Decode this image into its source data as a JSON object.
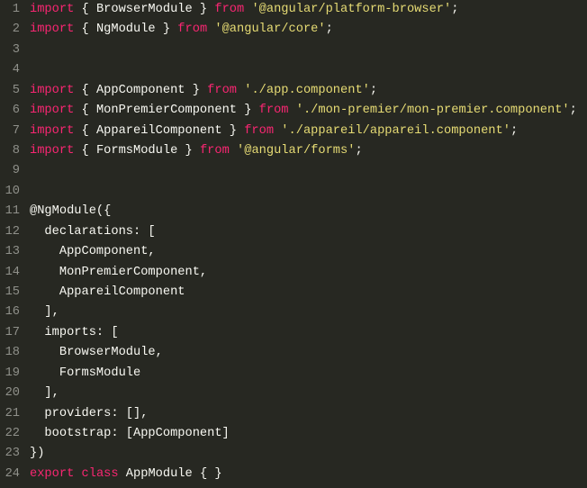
{
  "editor": {
    "theme_colors": {
      "background": "#272822",
      "keyword": "#f92672",
      "string": "#e6db74",
      "text": "#f8f8f2",
      "line_number": "#8f908a"
    },
    "lines": [
      [
        [
          "kw",
          "import"
        ],
        [
          "txt",
          " { BrowserModule } "
        ],
        [
          "kw",
          "from"
        ],
        [
          "txt",
          " "
        ],
        [
          "str",
          "'@angular/platform-browser'"
        ],
        [
          "txt",
          ";"
        ]
      ],
      [
        [
          "kw",
          "import"
        ],
        [
          "txt",
          " { NgModule } "
        ],
        [
          "kw",
          "from"
        ],
        [
          "txt",
          " "
        ],
        [
          "str",
          "'@angular/core'"
        ],
        [
          "txt",
          ";"
        ]
      ],
      [],
      [],
      [
        [
          "kw",
          "import"
        ],
        [
          "txt",
          " { AppComponent } "
        ],
        [
          "kw",
          "from"
        ],
        [
          "txt",
          " "
        ],
        [
          "str",
          "'./app.component'"
        ],
        [
          "txt",
          ";"
        ]
      ],
      [
        [
          "kw",
          "import"
        ],
        [
          "txt",
          " { MonPremierComponent } "
        ],
        [
          "kw",
          "from"
        ],
        [
          "txt",
          " "
        ],
        [
          "str",
          "'./mon-premier/mon-premier.component'"
        ],
        [
          "txt",
          ";"
        ]
      ],
      [
        [
          "kw",
          "import"
        ],
        [
          "txt",
          " { AppareilComponent } "
        ],
        [
          "kw",
          "from"
        ],
        [
          "txt",
          " "
        ],
        [
          "str",
          "'./appareil/appareil.component'"
        ],
        [
          "txt",
          ";"
        ]
      ],
      [
        [
          "kw",
          "import"
        ],
        [
          "txt",
          " { FormsModule } "
        ],
        [
          "kw",
          "from"
        ],
        [
          "txt",
          " "
        ],
        [
          "str",
          "'@angular/forms'"
        ],
        [
          "txt",
          ";"
        ]
      ],
      [],
      [],
      [
        [
          "txt",
          "@NgModule({"
        ]
      ],
      [
        [
          "txt",
          "  declarations: ["
        ]
      ],
      [
        [
          "txt",
          "    AppComponent,"
        ]
      ],
      [
        [
          "txt",
          "    MonPremierComponent,"
        ]
      ],
      [
        [
          "txt",
          "    AppareilComponent"
        ]
      ],
      [
        [
          "txt",
          "  ],"
        ]
      ],
      [
        [
          "txt",
          "  imports: ["
        ]
      ],
      [
        [
          "txt",
          "    BrowserModule,"
        ]
      ],
      [
        [
          "txt",
          "    FormsModule"
        ]
      ],
      [
        [
          "txt",
          "  ],"
        ]
      ],
      [
        [
          "txt",
          "  providers: [],"
        ]
      ],
      [
        [
          "txt",
          "  bootstrap: [AppComponent]"
        ]
      ],
      [
        [
          "txt",
          "})"
        ]
      ],
      [
        [
          "kw",
          "export"
        ],
        [
          "txt",
          " "
        ],
        [
          "kw",
          "class"
        ],
        [
          "txt",
          " AppModule { }"
        ]
      ]
    ]
  }
}
